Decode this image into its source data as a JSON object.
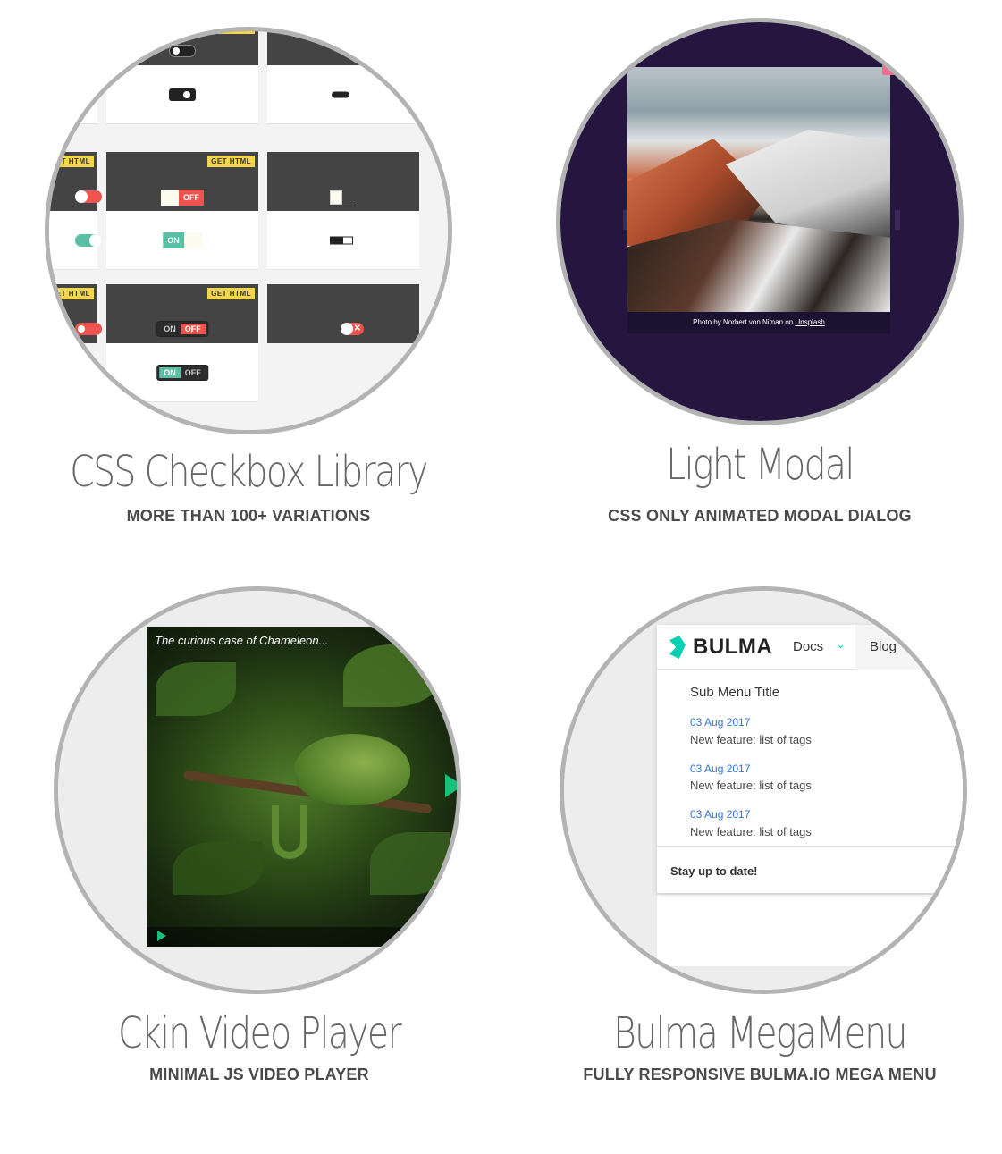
{
  "cards": [
    {
      "title": "CSS Checkbox Library",
      "subtitle": "MORE THAN 100+ VARIATIONS",
      "get_html": "GET HTML",
      "toggle_on": "ON",
      "toggle_off": "OFF"
    },
    {
      "title": "Light Modal",
      "subtitle": "CSS ONLY ANIMATED MODAL DIALOG",
      "caption_text": "Photo by Norbert von Niman on",
      "caption_link": "Unsplash",
      "close_symbol": "×"
    },
    {
      "title": "Ckin Video Player",
      "subtitle": "MINIMAL JS VIDEO PLAYER",
      "video_title": "The curious case of Chameleon..."
    },
    {
      "title": "Bulma MegaMenu",
      "subtitle": "FULLY RESPONSIVE BULMA.IO MEGA MENU",
      "brand": "BULMA",
      "nav_items": [
        "Docs",
        "Blog"
      ],
      "chevron": "⌄",
      "submenu_title": "Sub Menu Title",
      "entries": [
        {
          "date": "03 Aug 2017",
          "text": "New feature: list of tags"
        },
        {
          "date": "03 Aug 2017",
          "text": "New feature: list of tags"
        },
        {
          "date": "03 Aug 2017",
          "text": "New feature: list of tags"
        }
      ],
      "footer": "Stay up to date!"
    }
  ],
  "colors": {
    "toggle_red": "#ef5350",
    "toggle_teal": "#5bbfa6",
    "modal_bg": "#26153f",
    "play_green": "#19c07a",
    "bulma_turquoise": "#00d1b2",
    "link_blue": "#3273dc"
  }
}
